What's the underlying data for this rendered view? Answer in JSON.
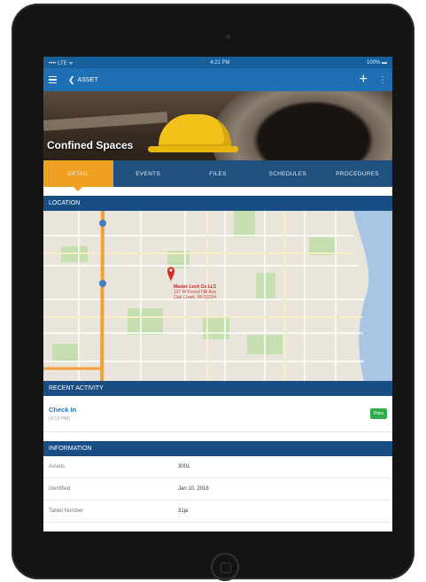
{
  "status_bar": {
    "carrier": "•••• LTE ᯤ",
    "time": "4:21 PM",
    "battery": "100% ▬"
  },
  "app_bar": {
    "back_label": "ASSET"
  },
  "hero": {
    "title": "Confined Spaces"
  },
  "tabs": [
    {
      "label": "DETAIL"
    },
    {
      "label": "EVENTS"
    },
    {
      "label": "FILES"
    },
    {
      "label": "SCHEDULES"
    },
    {
      "label": "PROCEDURES"
    }
  ],
  "location": {
    "header": "LOCATION",
    "pin_title": "Master Lock Co LLC",
    "pin_sub1": "137 W Forest Hill Ave",
    "pin_sub2": "Oak Creek, WI 53154"
  },
  "recent_activity": {
    "header": "RECENT ACTIVITY",
    "title": "Check In",
    "time": "(4:15 PM)",
    "badge": "Pass"
  },
  "information": {
    "header": "INFORMATION",
    "rows": [
      {
        "label": "Assets",
        "value": "3001"
      },
      {
        "label": "Identified",
        "value": "Jan 10, 2016"
      },
      {
        "label": "Tablet Number",
        "value": "31ja"
      }
    ]
  },
  "colors": {
    "primary": "#1f6fb4",
    "header": "#184e84",
    "tabs": "#20507e",
    "accent": "#f0a020",
    "pass": "#2eae4a"
  }
}
